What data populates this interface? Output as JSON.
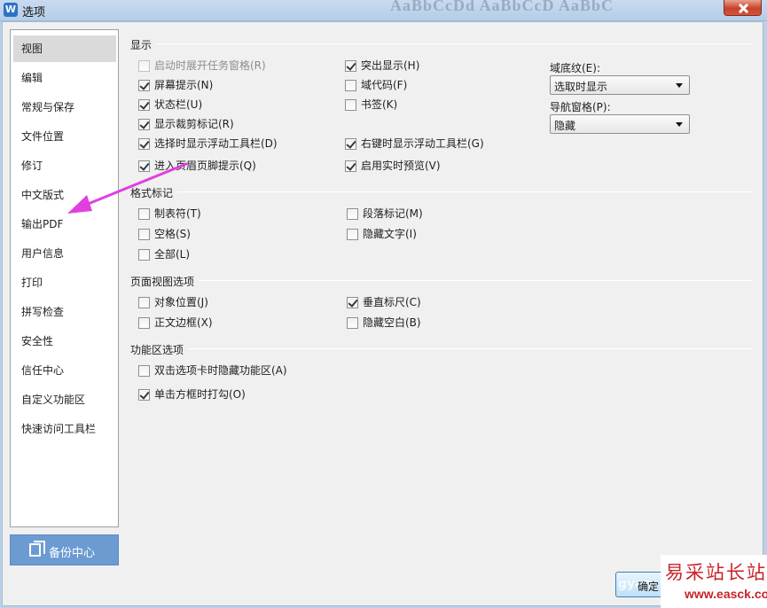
{
  "window": {
    "title": "选项",
    "app_icon_letter": "W",
    "title_ghost": "AaBbCcDd AaBbCcD AaBbC"
  },
  "sidebar": {
    "items": [
      {
        "label": "视图",
        "selected": true
      },
      {
        "label": "编辑"
      },
      {
        "label": "常规与保存"
      },
      {
        "label": "文件位置"
      },
      {
        "label": "修订"
      },
      {
        "label": "中文版式"
      },
      {
        "label": "输出PDF"
      },
      {
        "label": "用户信息"
      },
      {
        "label": "打印"
      },
      {
        "label": "拼写检查"
      },
      {
        "label": "安全性"
      },
      {
        "label": "信任中心"
      },
      {
        "label": "自定义功能区"
      },
      {
        "label": "快速访问工具栏"
      }
    ],
    "backup_label": "备份中心"
  },
  "display": {
    "title": "显示",
    "options": [
      {
        "label": "启动时展开任务窗格(R)",
        "checked": false,
        "disabled": true
      },
      {
        "label": "屏幕提示(N)",
        "checked": true
      },
      {
        "label": "状态栏(U)",
        "checked": true
      },
      {
        "label": "显示裁剪标记(R)",
        "checked": true
      },
      {
        "label": "选择时显示浮动工具栏(D)",
        "checked": true
      },
      {
        "label": "进入页眉页脚提示(Q)",
        "checked": true
      },
      {
        "label": "突出显示(H)",
        "checked": true
      },
      {
        "label": "域代码(F)",
        "checked": false
      },
      {
        "label": "书签(K)",
        "checked": false
      },
      {
        "label": "右键时显示浮动工具栏(G)",
        "checked": true
      },
      {
        "label": "启用实时预览(V)",
        "checked": true
      }
    ],
    "field_shading": {
      "label": "域底纹(E):",
      "value": "选取时显示"
    },
    "nav_pane": {
      "label": "导航窗格(P):",
      "value": "隐藏"
    }
  },
  "format_marks": {
    "title": "格式标记",
    "options": [
      {
        "label": "制表符(T)",
        "checked": false
      },
      {
        "label": "空格(S)",
        "checked": false
      },
      {
        "label": "全部(L)",
        "checked": false
      },
      {
        "label": "段落标记(M)",
        "checked": false
      },
      {
        "label": "隐藏文字(I)",
        "checked": false
      }
    ]
  },
  "page_view": {
    "title": "页面视图选项",
    "options": [
      {
        "label": "对象位置(J)",
        "checked": false
      },
      {
        "label": "正文边框(X)",
        "checked": false
      },
      {
        "label": "垂直标尺(C)",
        "checked": true
      },
      {
        "label": "隐藏空白(B)",
        "checked": false
      }
    ]
  },
  "ribbon": {
    "title": "功能区选项",
    "options": [
      {
        "label": "双击选项卡时隐藏功能区(A)",
        "checked": false
      },
      {
        "label": "单击方框时打勾(O)",
        "checked": true
      }
    ]
  },
  "footer": {
    "ok_label": "确定",
    "ok_ghost": "gyan"
  },
  "watermark": {
    "title": "易采站长站",
    "url": "www.easck.com"
  },
  "colors": {
    "annotation_arrow": "#e040e0",
    "watermark": "#c8242a",
    "backup_button": "#6c9bd2"
  }
}
